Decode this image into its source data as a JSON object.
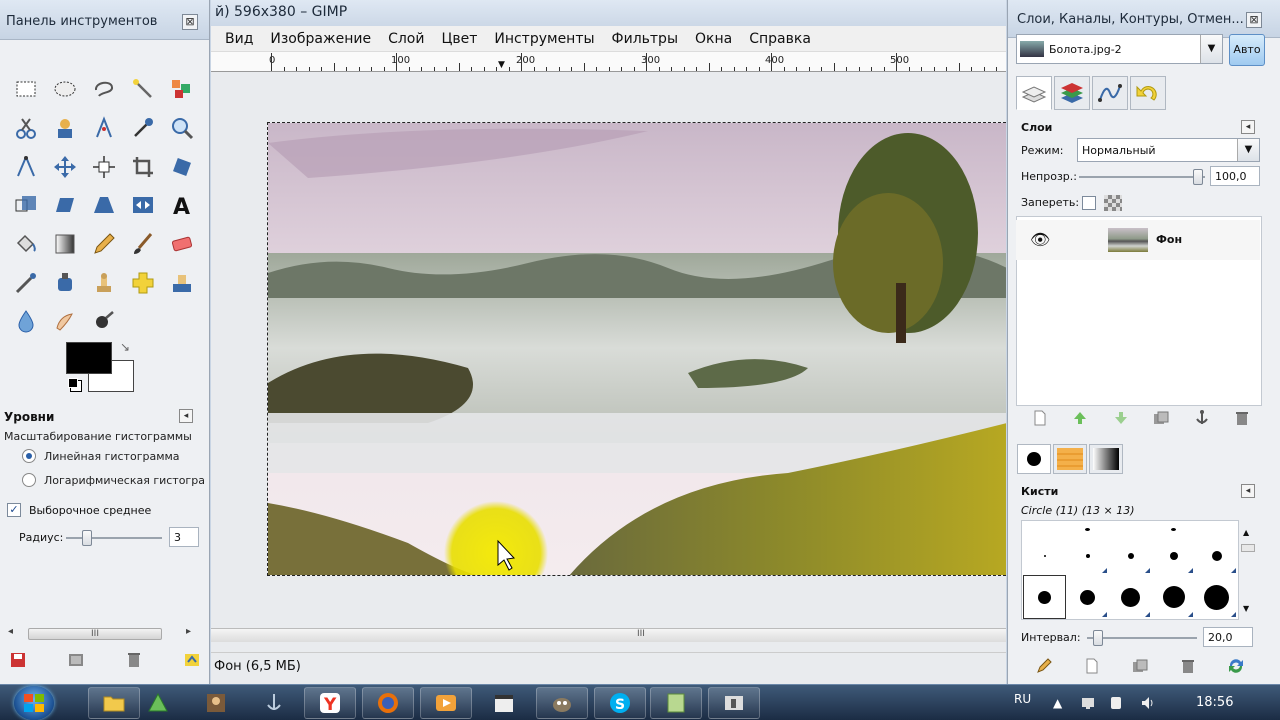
{
  "toolbox": {
    "title": "Панель инструментов",
    "close": "⊠",
    "options_title": "Уровни",
    "options_sub": "Масштабирование гистограммы",
    "radio_linear": "Линейная гистограмма",
    "radio_log": "Логарифмическая гистограмма",
    "sample_average": "Выборочное среднее",
    "radius_label": "Радиус:",
    "radius_value": "3",
    "scroll_grip": "III"
  },
  "image_window": {
    "title": "й) 596x380 – GIMP",
    "menu": [
      "Вид",
      "Изображение",
      "Слой",
      "Цвет",
      "Инструменты",
      "Фильтры",
      "Окна",
      "Справка"
    ],
    "ruler_labels": [
      "0",
      "100",
      "200",
      "300",
      "400",
      "500"
    ],
    "status": "Фон (6,5 МБ)",
    "hscroll_grip": "III"
  },
  "right_dock": {
    "title": "Слои, Каналы, Контуры, Отмен...",
    "close": "⊠",
    "image_combo": "Болота.jpg-2",
    "auto_button": "Авто",
    "layers": {
      "title": "Слои",
      "mode_label": "Режим:",
      "mode_value": "Нормальный",
      "opacity_label": "Непрозр.:",
      "opacity_value": "100,0",
      "opacity": 1.0,
      "lock_label": "Запереть:",
      "layer_name": "Фон"
    },
    "brushes": {
      "title": "Кисти",
      "selected": "Circle (11) (13 × 13)",
      "spacing_label": "Интервал:",
      "spacing_value": "20,0"
    }
  },
  "taskbar": {
    "lang": "RU",
    "clock": "18:56"
  },
  "colors": {
    "fg": "#000000",
    "bg": "#ffffff",
    "accent": "#2a5fa8",
    "cursor_highlight": "#f0e800"
  }
}
